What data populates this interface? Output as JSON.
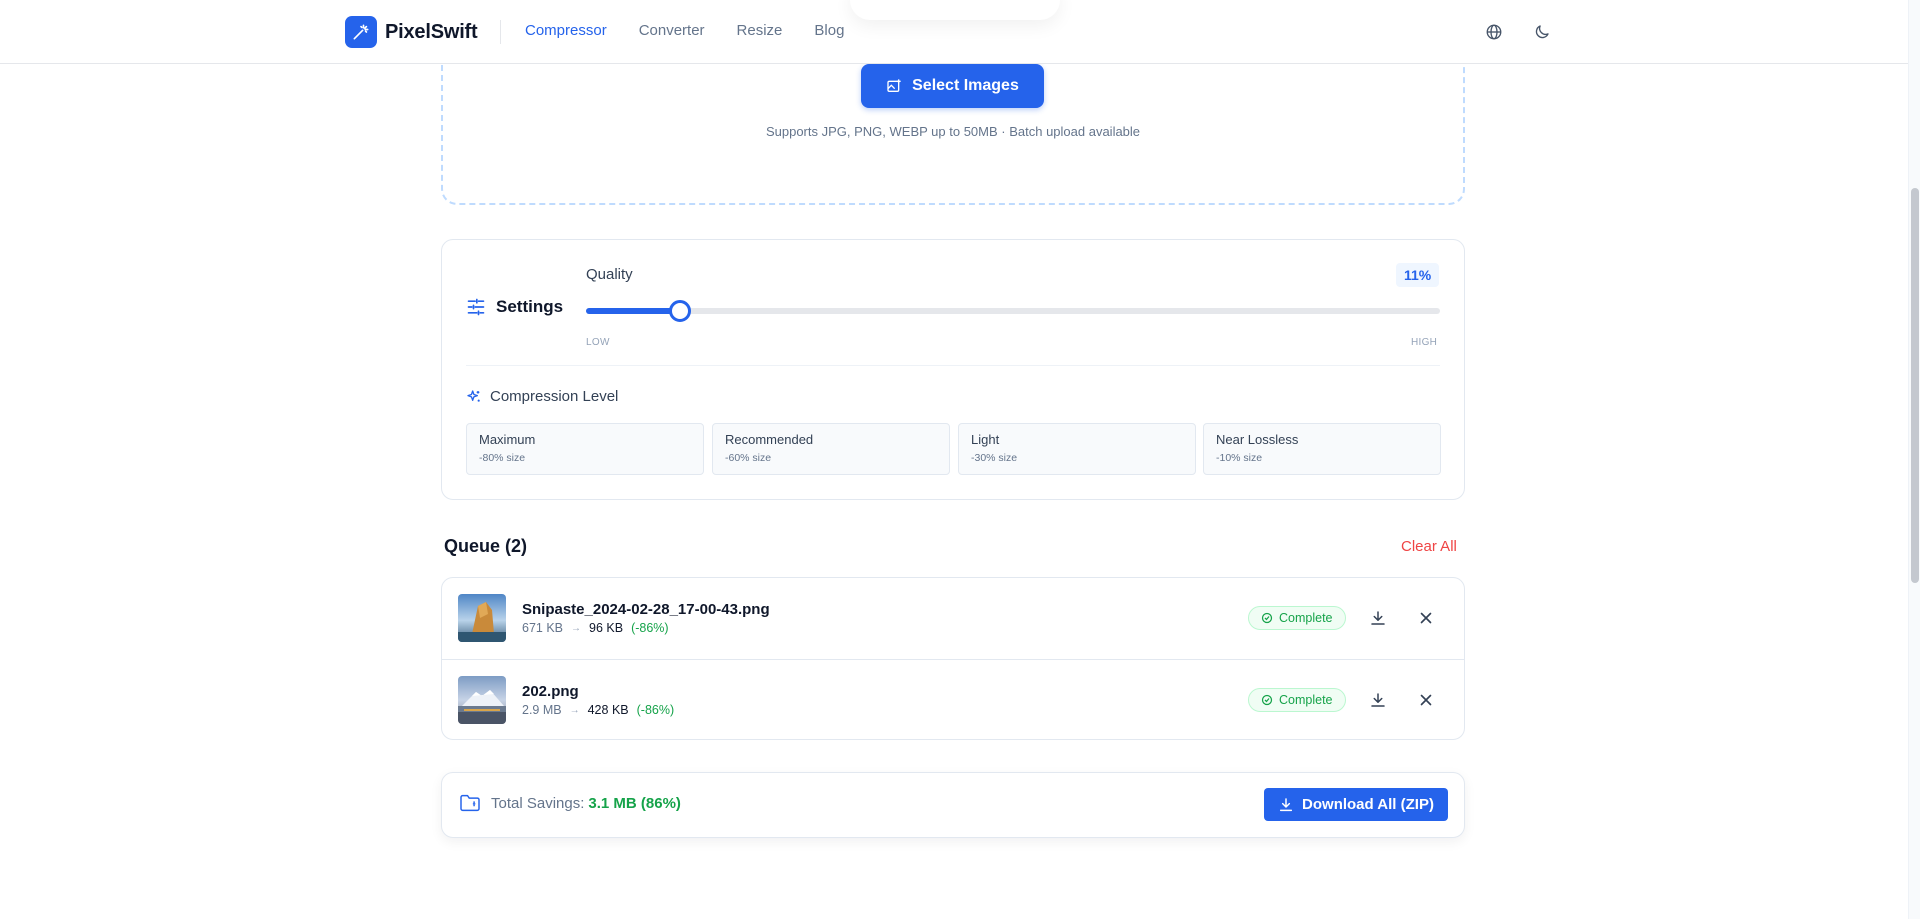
{
  "app": {
    "name": "PixelSwift"
  },
  "nav": {
    "items": [
      {
        "label": "Compressor",
        "active": true
      },
      {
        "label": "Converter",
        "active": false
      },
      {
        "label": "Resize",
        "active": false
      },
      {
        "label": "Blog",
        "active": false
      }
    ],
    "icons": [
      "globe-icon",
      "moon-icon"
    ]
  },
  "upload": {
    "button_label": "Select Images",
    "hint": "Supports JPG, PNG, WEBP up to 50MB · Batch upload available"
  },
  "settings": {
    "title": "Settings",
    "quality_label": "Quality",
    "quality_value": 11,
    "quality_display": "11%",
    "low_label": "LOW",
    "high_label": "HIGH",
    "level_title": "Compression Level",
    "levels": [
      {
        "name": "Maximum",
        "sub": "-80% size"
      },
      {
        "name": "Recommended",
        "sub": "-60% size"
      },
      {
        "name": "Light",
        "sub": "-30% size"
      },
      {
        "name": "Near Lossless",
        "sub": "-10% size"
      }
    ]
  },
  "queue": {
    "title": "Queue (2)",
    "clear_label": "Clear All",
    "items": [
      {
        "name": "Snipaste_2024-02-28_17-00-43.png",
        "original": "671 KB",
        "compressed": "96 KB",
        "savings": "(-86%)",
        "status": "Complete"
      },
      {
        "name": "202.png",
        "original": "2.9 MB",
        "compressed": "428 KB",
        "savings": "(-86%)",
        "status": "Complete"
      }
    ]
  },
  "summary": {
    "label": "Total Savings:",
    "value": "3.1 MB (86%)",
    "download_label": "Download All (ZIP)"
  },
  "colors": {
    "accent": "#2563eb",
    "success": "#16a34a",
    "danger": "#ef4444"
  }
}
